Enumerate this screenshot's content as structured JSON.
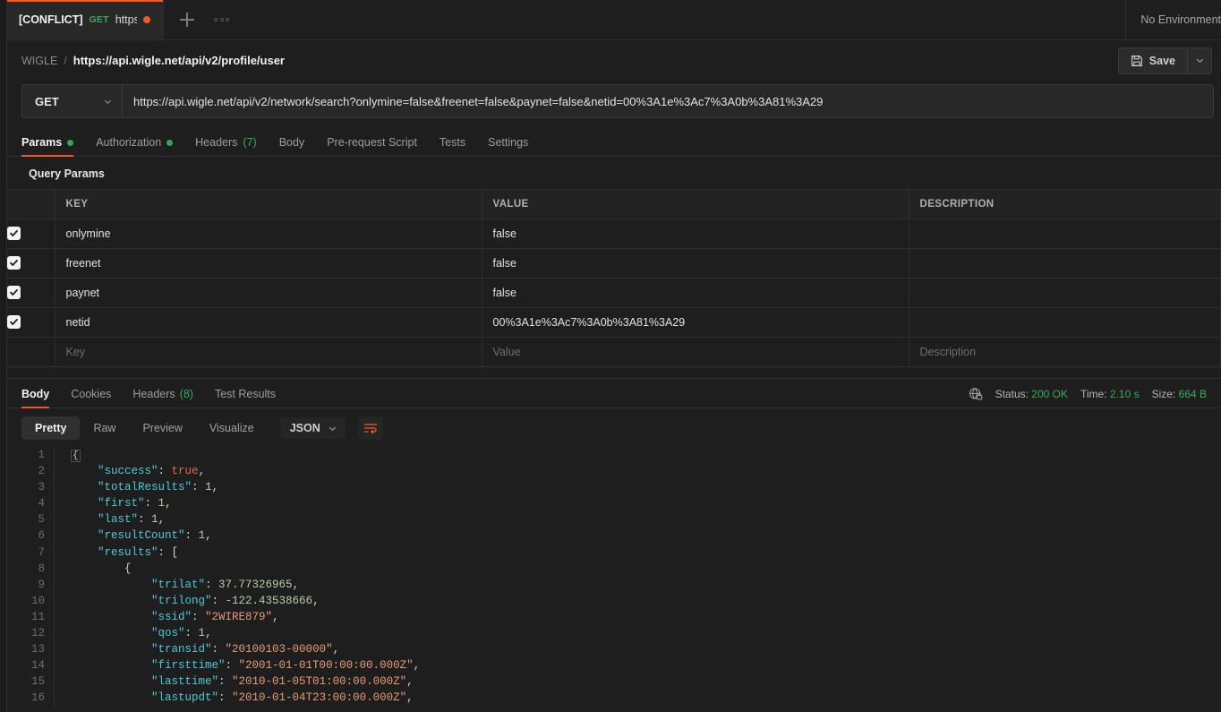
{
  "tabstrip": {
    "tab": {
      "conflict_label": "[CONFLICT]",
      "method": "GET",
      "url_short": "https:..."
    },
    "new_tab_label": "+",
    "more_label": "···",
    "environment": "No Environment"
  },
  "breadcrumb": {
    "collection": "WIGLE",
    "separator": "/",
    "request_name": "https://api.wigle.net/api/v2/profile/user",
    "save_label": "Save"
  },
  "request": {
    "method": "GET",
    "url": "https://api.wigle.net/api/v2/network/search?onlymine=false&freenet=false&paynet=false&netid=00%3A1e%3Ac7%3A0b%3A81%3A29",
    "tabs": [
      {
        "label": "Params",
        "dot": true,
        "active": true
      },
      {
        "label": "Authorization",
        "dot": true,
        "active": false
      },
      {
        "label": "Headers",
        "count": "(7)",
        "active": false
      },
      {
        "label": "Body",
        "active": false
      },
      {
        "label": "Pre-request Script",
        "active": false
      },
      {
        "label": "Tests",
        "active": false
      },
      {
        "label": "Settings",
        "active": false
      }
    ]
  },
  "params": {
    "section_title": "Query Params",
    "headers": {
      "key": "KEY",
      "value": "VALUE",
      "description": "DESCRIPTION"
    },
    "rows": [
      {
        "checked": true,
        "key": "onlymine",
        "value": "false",
        "description": ""
      },
      {
        "checked": true,
        "key": "freenet",
        "value": "false",
        "description": ""
      },
      {
        "checked": true,
        "key": "paynet",
        "value": "false",
        "description": ""
      },
      {
        "checked": true,
        "key": "netid",
        "value": "00%3A1e%3Ac7%3A0b%3A81%3A29",
        "description": ""
      }
    ],
    "placeholder_row": {
      "key": "Key",
      "value": "Value",
      "description": "Description"
    }
  },
  "response": {
    "tabs": [
      {
        "label": "Body",
        "active": true
      },
      {
        "label": "Cookies",
        "active": false
      },
      {
        "label": "Headers",
        "count": "(8)",
        "active": false
      },
      {
        "label": "Test Results",
        "active": false
      }
    ],
    "status_label": "Status:",
    "status_value": "200 OK",
    "time_label": "Time:",
    "time_value": "2.10 s",
    "size_label": "Size:",
    "size_value": "664 B",
    "view_modes": [
      {
        "label": "Pretty",
        "active": true
      },
      {
        "label": "Raw",
        "active": false
      },
      {
        "label": "Preview",
        "active": false
      },
      {
        "label": "Visualize",
        "active": false
      }
    ],
    "format": "JSON"
  },
  "colors": {
    "accent": "#ef5b25",
    "success": "#3aaa5c",
    "bg": "#1e1e1e",
    "panel": "#282828",
    "border": "#2e2e2e",
    "json_key": "#4ec9d9",
    "json_string": "#e89a74",
    "json_number": "#b5cea8",
    "json_bool": "#e06c4e"
  },
  "code_lines": [
    {
      "n": 1,
      "indent": 0,
      "tokens": [
        {
          "t": "fold",
          "v": "{"
        }
      ]
    },
    {
      "n": 2,
      "indent": 1,
      "tokens": [
        {
          "t": "k",
          "v": "\"success\""
        },
        {
          "t": "p",
          "v": ": "
        },
        {
          "t": "b",
          "v": "true"
        },
        {
          "t": "p",
          "v": ","
        }
      ]
    },
    {
      "n": 3,
      "indent": 1,
      "tokens": [
        {
          "t": "k",
          "v": "\"totalResults\""
        },
        {
          "t": "p",
          "v": ": "
        },
        {
          "t": "n",
          "v": "1"
        },
        {
          "t": "p",
          "v": ","
        }
      ]
    },
    {
      "n": 4,
      "indent": 1,
      "tokens": [
        {
          "t": "k",
          "v": "\"first\""
        },
        {
          "t": "p",
          "v": ": "
        },
        {
          "t": "n",
          "v": "1"
        },
        {
          "t": "p",
          "v": ","
        }
      ]
    },
    {
      "n": 5,
      "indent": 1,
      "tokens": [
        {
          "t": "k",
          "v": "\"last\""
        },
        {
          "t": "p",
          "v": ": "
        },
        {
          "t": "n",
          "v": "1"
        },
        {
          "t": "p",
          "v": ","
        }
      ]
    },
    {
      "n": 6,
      "indent": 1,
      "tokens": [
        {
          "t": "k",
          "v": "\"resultCount\""
        },
        {
          "t": "p",
          "v": ": "
        },
        {
          "t": "n",
          "v": "1"
        },
        {
          "t": "p",
          "v": ","
        }
      ]
    },
    {
      "n": 7,
      "indent": 1,
      "tokens": [
        {
          "t": "k",
          "v": "\"results\""
        },
        {
          "t": "p",
          "v": ": ["
        }
      ]
    },
    {
      "n": 8,
      "indent": 2,
      "tokens": [
        {
          "t": "p",
          "v": "{"
        }
      ]
    },
    {
      "n": 9,
      "indent": 3,
      "tokens": [
        {
          "t": "k",
          "v": "\"trilat\""
        },
        {
          "t": "p",
          "v": ": "
        },
        {
          "t": "n",
          "v": "37.77326965"
        },
        {
          "t": "p",
          "v": ","
        }
      ]
    },
    {
      "n": 10,
      "indent": 3,
      "tokens": [
        {
          "t": "k",
          "v": "\"trilong\""
        },
        {
          "t": "p",
          "v": ": "
        },
        {
          "t": "n",
          "v": "-122.43538666"
        },
        {
          "t": "p",
          "v": ","
        }
      ]
    },
    {
      "n": 11,
      "indent": 3,
      "tokens": [
        {
          "t": "k",
          "v": "\"ssid\""
        },
        {
          "t": "p",
          "v": ": "
        },
        {
          "t": "s",
          "v": "\"2WIRE879\""
        },
        {
          "t": "p",
          "v": ","
        }
      ]
    },
    {
      "n": 12,
      "indent": 3,
      "tokens": [
        {
          "t": "k",
          "v": "\"qos\""
        },
        {
          "t": "p",
          "v": ": "
        },
        {
          "t": "n",
          "v": "1"
        },
        {
          "t": "p",
          "v": ","
        }
      ]
    },
    {
      "n": 13,
      "indent": 3,
      "tokens": [
        {
          "t": "k",
          "v": "\"transid\""
        },
        {
          "t": "p",
          "v": ": "
        },
        {
          "t": "s",
          "v": "\"20100103-00000\""
        },
        {
          "t": "p",
          "v": ","
        }
      ]
    },
    {
      "n": 14,
      "indent": 3,
      "tokens": [
        {
          "t": "k",
          "v": "\"firsttime\""
        },
        {
          "t": "p",
          "v": ": "
        },
        {
          "t": "s",
          "v": "\"2001-01-01T00:00:00.000Z\""
        },
        {
          "t": "p",
          "v": ","
        }
      ]
    },
    {
      "n": 15,
      "indent": 3,
      "tokens": [
        {
          "t": "k",
          "v": "\"lasttime\""
        },
        {
          "t": "p",
          "v": ": "
        },
        {
          "t": "s",
          "v": "\"2010-01-05T01:00:00.000Z\""
        },
        {
          "t": "p",
          "v": ","
        }
      ]
    },
    {
      "n": 16,
      "indent": 3,
      "tokens": [
        {
          "t": "k",
          "v": "\"lastupdt\""
        },
        {
          "t": "p",
          "v": ": "
        },
        {
          "t": "s",
          "v": "\"2010-01-04T23:00:00.000Z\""
        },
        {
          "t": "p",
          "v": ","
        }
      ]
    }
  ]
}
